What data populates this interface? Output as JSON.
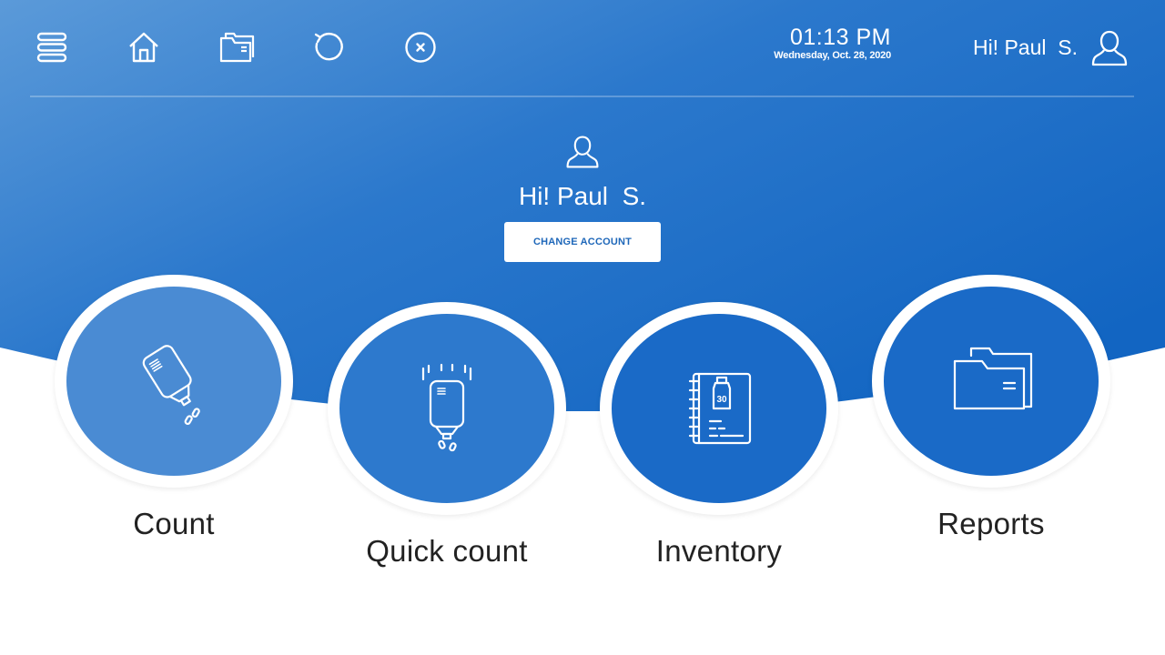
{
  "colors": {
    "bg_light": "#5b9ad9",
    "bg_dark": "#1265c2",
    "disc_light": "#4a8bd3",
    "disc_mid": "#2d79cd",
    "disc_dark": "#1a6ac7",
    "text_dark": "#222222",
    "button_text": "#1e67b9"
  },
  "header": {
    "icons": [
      "menu-icon",
      "home-icon",
      "folder-icon",
      "undo-icon",
      "close-icon"
    ],
    "time": "01:13 PM",
    "date": "Wednesday, Oct. 28, 2020",
    "greeting": "Hi! Paul  S.",
    "avatar_icon": "user-icon"
  },
  "profile": {
    "icon": "user-icon",
    "greeting": "Hi! Paul  S.",
    "change_account_label": "CHANGE ACCOUNT"
  },
  "tiles": [
    {
      "label": "Count",
      "icon": "iv-bag-icon"
    },
    {
      "label": "Quick count",
      "icon": "iv-bag-drop-icon"
    },
    {
      "label": "Inventory",
      "icon": "notebook-bottle-icon",
      "badge": "30"
    },
    {
      "label": "Reports",
      "icon": "folders-icon"
    }
  ]
}
